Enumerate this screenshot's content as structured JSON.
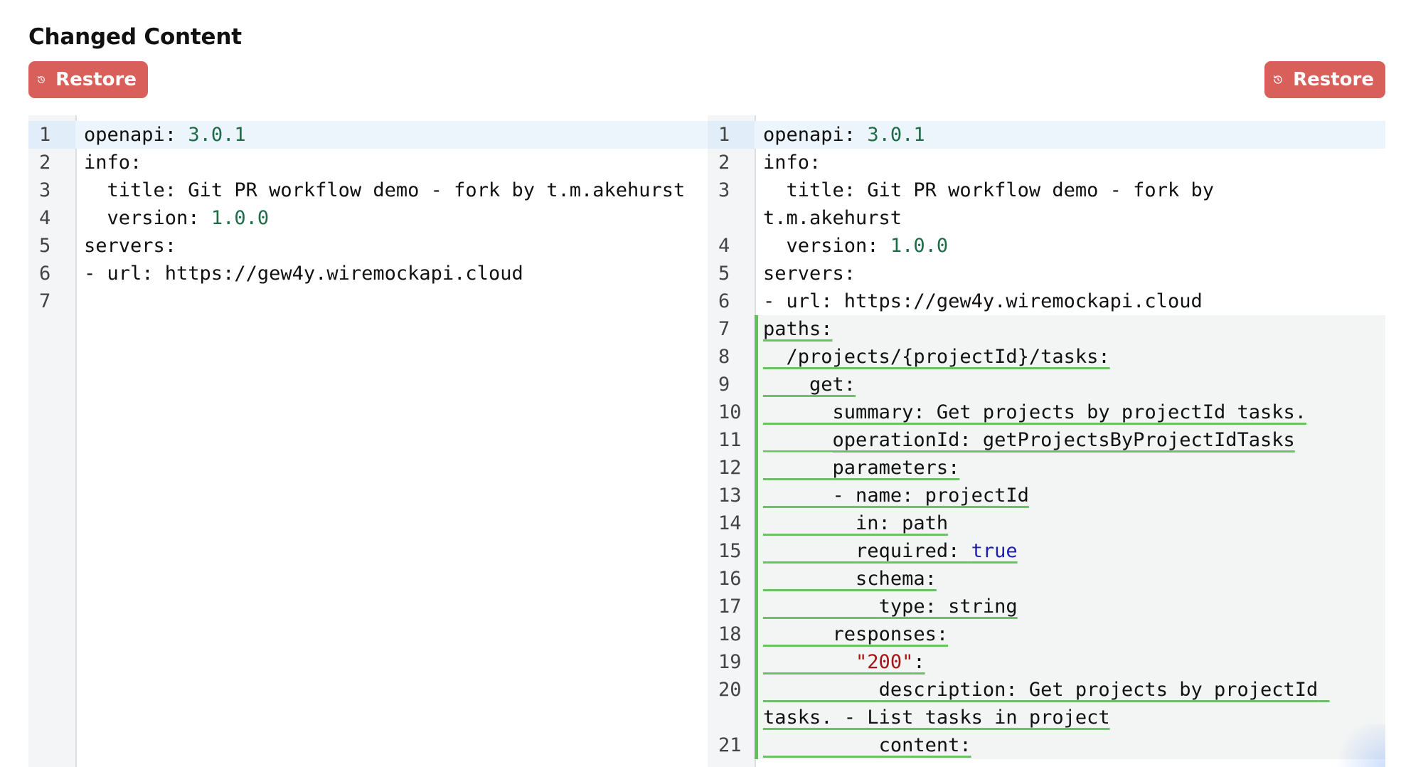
{
  "header": {
    "title": "Changed Content"
  },
  "buttons": {
    "restore_left": "Restore",
    "restore_right": "Restore"
  },
  "left_pane": {
    "lines": [
      {
        "n": "1",
        "t": "openapi: ",
        "v": "3.0.1"
      },
      {
        "n": "2",
        "t": "info:"
      },
      {
        "n": "3",
        "t": "  title: Git PR workflow demo - fork by t.m.akehurst"
      },
      {
        "n": "4",
        "t": "  version: ",
        "v": "1.0.0"
      },
      {
        "n": "5",
        "t": "servers:"
      },
      {
        "n": "6",
        "t": "- url: https://gew4y.wiremockapi.cloud"
      },
      {
        "n": "7",
        "t": ""
      }
    ]
  },
  "right_pane": {
    "lines": [
      {
        "n": "1",
        "t": "openapi: ",
        "v": "3.0.1"
      },
      {
        "n": "2",
        "t": "info:"
      },
      {
        "n": "3",
        "t": "  title: Git PR workflow demo - fork by t.m.akehurst"
      },
      {
        "n": "4",
        "t": "  version: ",
        "v": "1.0.0"
      },
      {
        "n": "5",
        "t": "servers:"
      },
      {
        "n": "6",
        "t": "- url: https://gew4y.wiremockapi.cloud"
      },
      {
        "n": "7",
        "t": "paths:",
        "added": true
      },
      {
        "n": "8",
        "t": "  /projects/{projectId}/tasks:",
        "added": true
      },
      {
        "n": "9",
        "t": "    get:",
        "added": true
      },
      {
        "n": "10",
        "t": "      summary: Get projects by projectId tasks.",
        "added": true
      },
      {
        "n": "11",
        "t": "      operationId: getProjectsByProjectIdTasks",
        "added": true
      },
      {
        "n": "12",
        "t": "      parameters:",
        "added": true
      },
      {
        "n": "13",
        "t": "      - name: projectId",
        "added": true
      },
      {
        "n": "14",
        "t": "        in: path",
        "added": true
      },
      {
        "n": "15",
        "t": "        required: ",
        "k": "true",
        "added": true
      },
      {
        "n": "16",
        "t": "        schema:",
        "added": true
      },
      {
        "n": "17",
        "t": "          type: string",
        "added": true
      },
      {
        "n": "18",
        "t": "      responses:",
        "added": true
      },
      {
        "n": "19",
        "t": "        ",
        "s": "\"200\"",
        "after": ":",
        "added": true
      },
      {
        "n": "20",
        "t": "          description: Get projects by projectId tasks. - List tasks in project",
        "added": true
      },
      {
        "n": "21",
        "t": "          content:",
        "added": true
      }
    ]
  },
  "icons": {
    "restore": "history-icon"
  },
  "colors": {
    "button": "#d95f5a",
    "added_marker": "#64bf5d",
    "number": "#1e6b48",
    "keyword": "#1d1db3",
    "string": "#a51515"
  }
}
